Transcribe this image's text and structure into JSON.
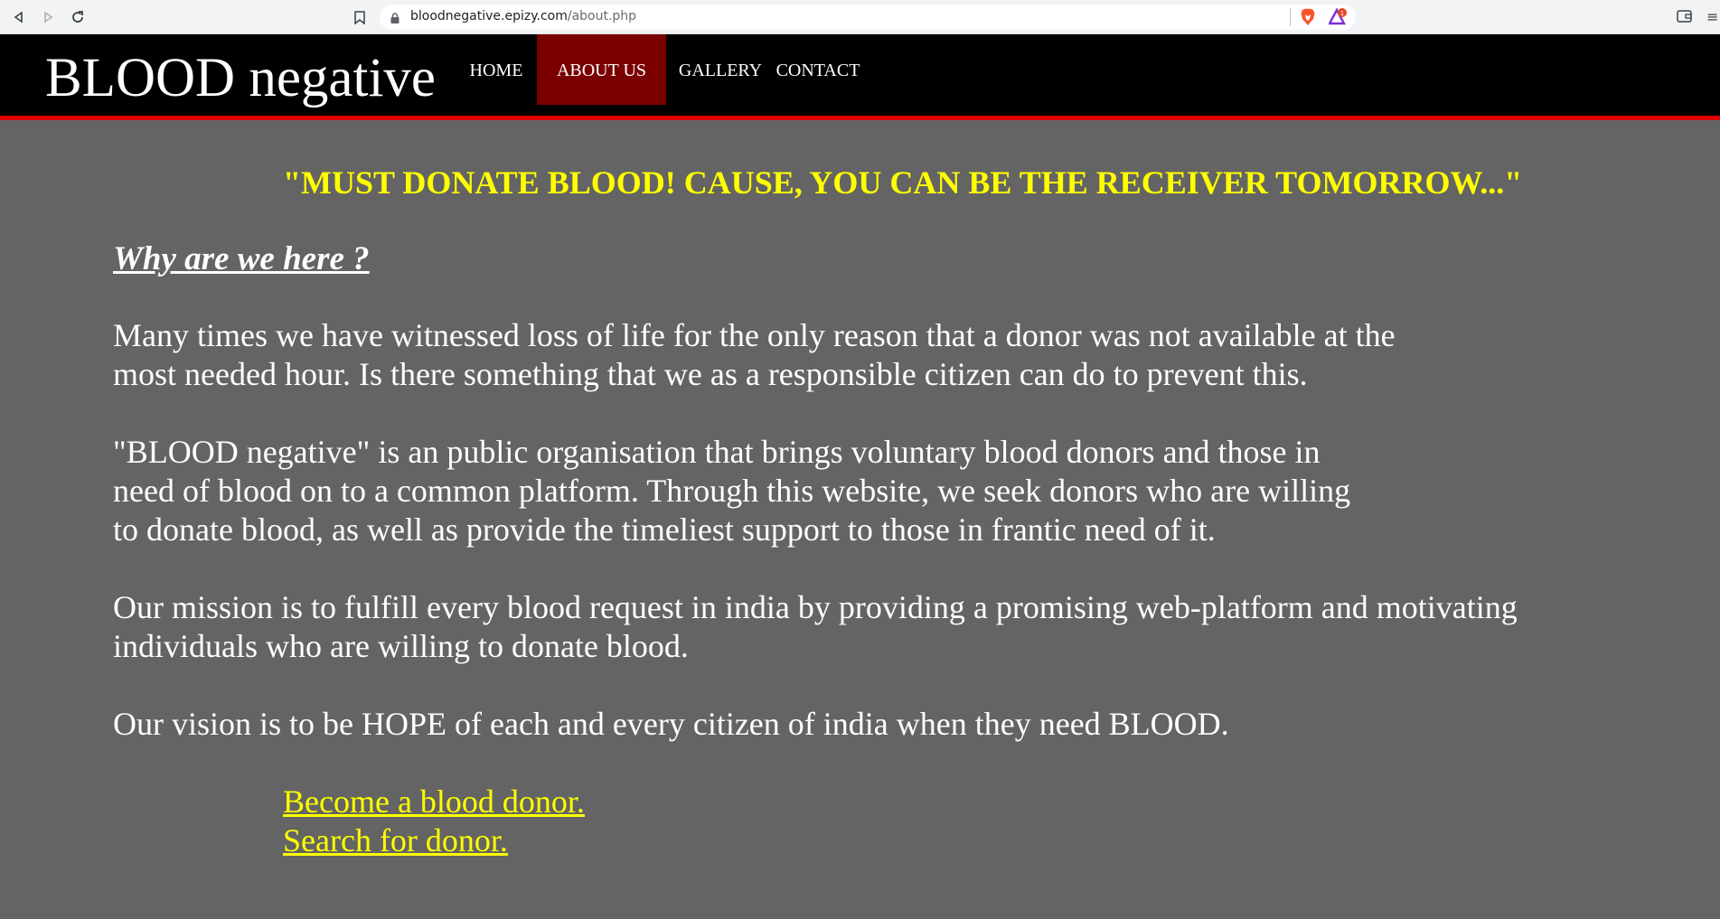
{
  "browser": {
    "url_host": "bloodnegative.epizy.com",
    "url_path": "/about.php",
    "ext_badge": "1"
  },
  "site": {
    "brand": "BLOOD negative",
    "nav": [
      {
        "label": "HOME",
        "active": false
      },
      {
        "label": "ABOUT US",
        "active": true
      },
      {
        "label": "GALLERY",
        "active": false
      },
      {
        "label": "CONTACT",
        "active": false
      }
    ]
  },
  "content": {
    "tagline": "\"MUST DONATE BLOOD! CAUSE, YOU CAN BE THE RECEIVER TOMORROW...\"",
    "heading": "Why are we here ?",
    "paragraphs": [
      {
        "lines": [
          "Many times we have witnessed loss of life for the only reason that a donor was not available at the",
          "most needed hour. Is there something that we as a responsible citizen can do to prevent this."
        ]
      },
      {
        "lines": [
          "\"BLOOD negative\" is an public organisation that brings voluntary blood donors and those in",
          "need of blood on to a common platform. Through this website, we seek donors who are willing",
          "to donate blood, as well as provide the timeliest support to those in frantic need of it."
        ]
      },
      {
        "lines": [
          "Our mission is to fulfill every blood request in india by providing a promising web-platform and motivating",
          "individuals who are willing to donate blood."
        ]
      },
      {
        "lines": [
          "Our vision is to be HOPE of each and every citizen of india when they need BLOOD."
        ]
      }
    ],
    "links": [
      {
        "label": "Become a blood donor."
      },
      {
        "label": "Search for donor."
      }
    ]
  },
  "colors": {
    "page_bg": "#646464",
    "header_bg": "#000000",
    "header_border": "#e00000",
    "active_nav_bg": "#7a0000",
    "accent_yellow": "#ffff00"
  }
}
